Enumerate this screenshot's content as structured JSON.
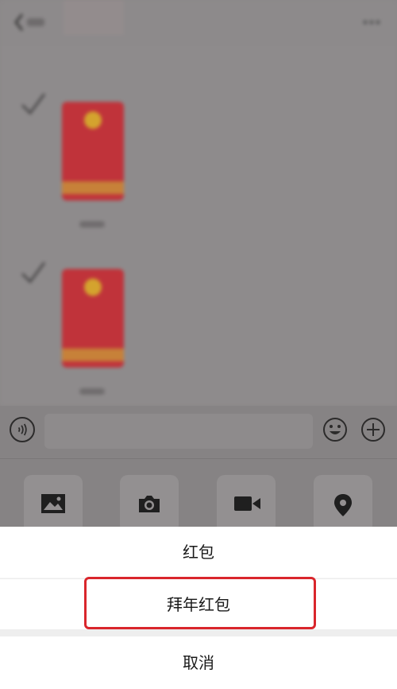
{
  "chat": {
    "title": "",
    "messages": [
      {
        "type": "red-packet"
      },
      {
        "type": "red-packet"
      }
    ]
  },
  "input_bar": {
    "voice_icon": "voice-icon",
    "emoji_icon": "emoji-icon",
    "plus_icon": "plus-icon"
  },
  "panel": {
    "items": [
      {
        "icon": "image-icon"
      },
      {
        "icon": "camera-icon"
      },
      {
        "icon": "video-icon"
      },
      {
        "icon": "location-icon"
      }
    ]
  },
  "action_sheet": {
    "item_1": "红包",
    "item_2": "拜年红包",
    "cancel": "取消",
    "highlight_color": "#d9262c"
  },
  "colors": {
    "red_packet": "#c0333a",
    "overlay": "#8a8788"
  }
}
